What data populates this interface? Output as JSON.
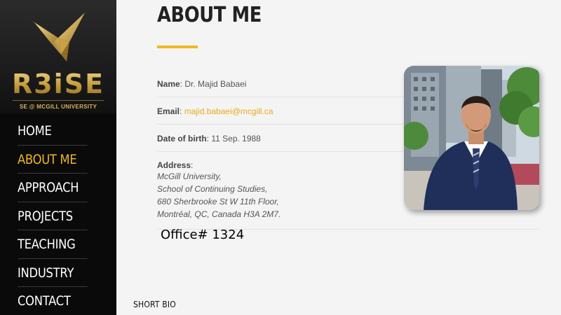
{
  "brand": {
    "wordmark": "R3iSE",
    "tagline": "SE @ MCGILL UNIVERSITY",
    "gold": "#d4a94a"
  },
  "nav": {
    "items": [
      {
        "label": "HOME"
      },
      {
        "label": "ABOUT ME",
        "active": true
      },
      {
        "label": "APPROACH"
      },
      {
        "label": "PROJECTS"
      },
      {
        "label": "TEACHING"
      },
      {
        "label": "INDUSTRY"
      },
      {
        "label": "CONTACT"
      }
    ],
    "active_color": "#f2b81f"
  },
  "main": {
    "title": "ABOUT ME",
    "name_label": "Name",
    "name_value": "Dr. Majid Babaei",
    "email_label": "Email",
    "email_value": "majid.babaei@mcgill.ca",
    "dob_label": "Date of birth",
    "dob_value": "11 Sep. 1988",
    "address_label": "Address",
    "address_lines": [
      "McGill University,",
      "School of Continuing Studies,",
      "680 Sherbrooke St W 11th Floor,",
      "Montréal, QC, Canada H3A 2M7."
    ],
    "office": "Office# 1324",
    "short_bio_heading": "SHORT BIO"
  },
  "photo": {
    "icon": "portrait-photo"
  }
}
